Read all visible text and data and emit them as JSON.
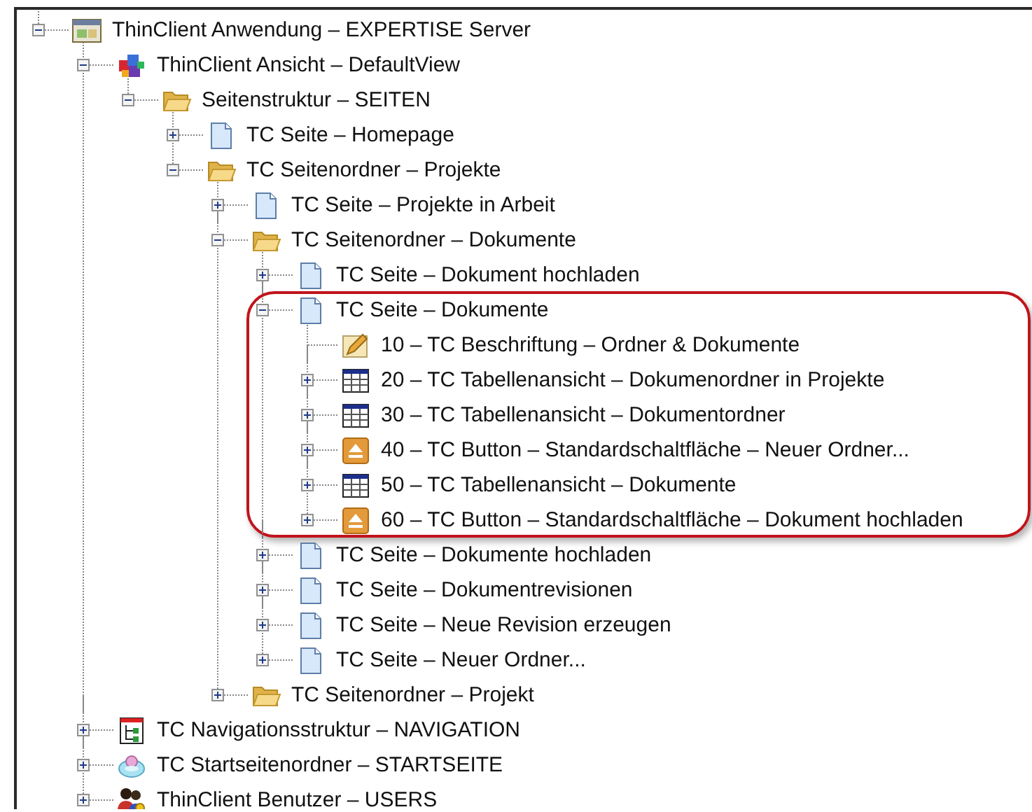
{
  "tree": [
    {
      "label": "ThinClient Anwendung – EXPERTISE Server",
      "kind": "application",
      "expanded": true,
      "children": [
        {
          "label": "ThinClient Ansicht – DefaultView",
          "kind": "view",
          "expanded": true,
          "children": [
            {
              "label": "Seitenstruktur – SEITEN",
              "kind": "folder",
              "expanded": true,
              "children": [
                {
                  "label": "TC Seite – Homepage",
                  "kind": "page",
                  "expanded": false
                },
                {
                  "label": "TC Seitenordner – Projekte",
                  "kind": "folder",
                  "expanded": true,
                  "children": [
                    {
                      "label": "TC Seite – Projekte in Arbeit",
                      "kind": "page",
                      "expanded": false
                    },
                    {
                      "label": "TC Seitenordner – Dokumente",
                      "kind": "folder",
                      "expanded": true,
                      "children": [
                        {
                          "label": "TC Seite – Dokument hochladen",
                          "kind": "page",
                          "expanded": false,
                          "highlighted": false
                        },
                        {
                          "label": "TC Seite – Dokumente",
                          "kind": "page",
                          "expanded": true,
                          "highlighted": true,
                          "children": [
                            {
                              "label": "10 – TC Beschriftung – Ordner & Dokumente",
                              "kind": "label"
                            },
                            {
                              "label": "20 – TC Tabellenansicht – Dokumenordner in Projekte",
                              "kind": "table",
                              "expanded": false
                            },
                            {
                              "label": "30 – TC Tabellenansicht – Dokumentordner",
                              "kind": "table",
                              "expanded": false
                            },
                            {
                              "label": "40 – TC Button – Standardschaltfläche – Neuer Ordner...",
                              "kind": "button",
                              "expanded": false
                            },
                            {
                              "label": "50 – TC Tabellenansicht – Dokumente",
                              "kind": "table",
                              "expanded": false
                            },
                            {
                              "label": "60 – TC Button – Standardschaltfläche – Dokument hochladen",
                              "kind": "button",
                              "expanded": false
                            }
                          ]
                        },
                        {
                          "label": "TC Seite – Dokumente hochladen",
                          "kind": "page",
                          "expanded": false,
                          "highlighted": false
                        },
                        {
                          "label": "TC Seite – Dokumentrevisionen",
                          "kind": "page",
                          "expanded": false,
                          "highlighted": false
                        },
                        {
                          "label": "TC Seite – Neue Revision erzeugen",
                          "kind": "page",
                          "expanded": false,
                          "highlighted": false
                        },
                        {
                          "label": "TC Seite – Neuer Ordner...",
                          "kind": "page",
                          "expanded": false,
                          "highlighted": false
                        }
                      ]
                    },
                    {
                      "label": "TC Seitenordner – Projekt",
                      "kind": "folder",
                      "expanded": false
                    }
                  ]
                }
              ]
            }
          ]
        },
        {
          "label": "TC Navigationsstruktur – NAVIGATION",
          "kind": "navigation",
          "expanded": false
        },
        {
          "label": "TC Startseitenordner – STARTSEITE",
          "kind": "start-folder",
          "expanded": false
        },
        {
          "label": "ThinClient Benutzer – USERS",
          "kind": "users",
          "expanded": false
        }
      ]
    }
  ]
}
